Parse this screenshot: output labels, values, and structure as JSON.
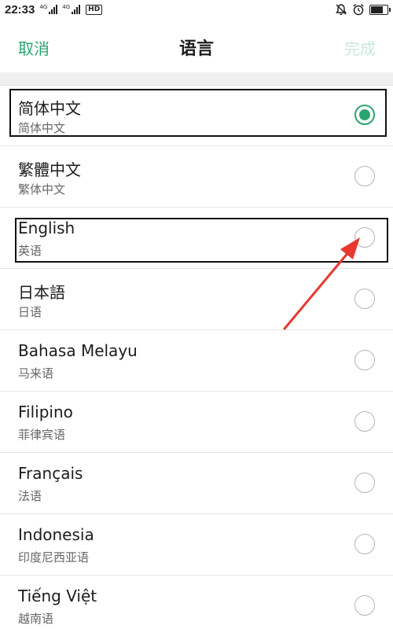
{
  "status_bar": {
    "time": "22:33",
    "sim1_tag": "4G",
    "sim2_tag": "4G",
    "hd_label": "HD",
    "battery_level": 0.7
  },
  "nav": {
    "cancel_label": "取消",
    "title": "语言",
    "done_label": "完成"
  },
  "languages": [
    {
      "name": "简体中文",
      "sub": "简体中文",
      "selected": true
    },
    {
      "name": "繁體中文",
      "sub": "繁体中文",
      "selected": false
    },
    {
      "name": "English",
      "sub": "英语",
      "selected": false
    },
    {
      "name": "日本語",
      "sub": "日语",
      "selected": false
    },
    {
      "name": "Bahasa Melayu",
      "sub": "马来语",
      "selected": false
    },
    {
      "name": "Filipino",
      "sub": "菲律宾语",
      "selected": false
    },
    {
      "name": "Français",
      "sub": "法语",
      "selected": false
    },
    {
      "name": "Indonesia",
      "sub": "印度尼西亚语",
      "selected": false
    },
    {
      "name": "Tiếng Việt",
      "sub": "越南语",
      "selected": false
    }
  ],
  "colors": {
    "accent": "#2aa56f",
    "done_disabled": "#c9e8d9",
    "annotation_arrow": "#e8382f"
  }
}
